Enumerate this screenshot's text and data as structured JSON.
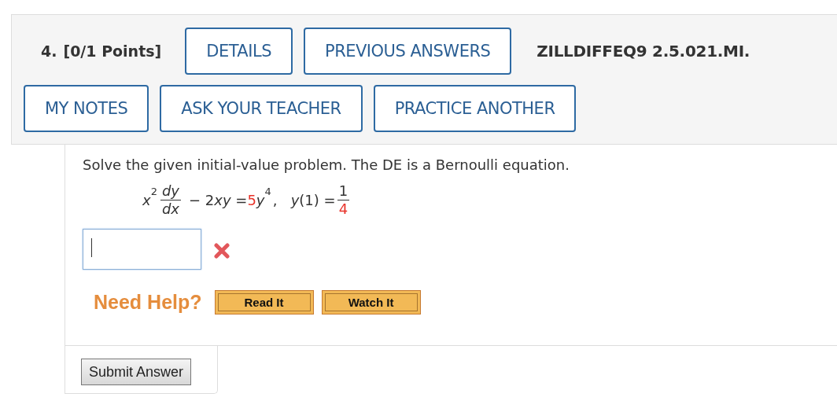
{
  "question": {
    "number": "4.",
    "points": "[0/1 Points]",
    "code": "ZILLDIFFEQ9 2.5.021.MI."
  },
  "header_buttons_row1": [
    {
      "label": "DETAILS"
    },
    {
      "label": "PREVIOUS ANSWERS"
    }
  ],
  "header_buttons_row2": [
    {
      "label": "MY NOTES"
    },
    {
      "label": "ASK YOUR TEACHER"
    },
    {
      "label": "PRACTICE ANOTHER"
    }
  ],
  "prompt": "Solve the given initial-value problem. The DE is a Bernoulli equation.",
  "equation": [
    {
      "kind": "text",
      "text": "x",
      "italic": true
    },
    {
      "kind": "sup",
      "text": "2"
    },
    {
      "kind": "frac",
      "num": "dy",
      "den": "dx",
      "italic": true
    },
    {
      "kind": "text",
      "text": "− 2",
      "italic": false
    },
    {
      "kind": "text",
      "text": "xy",
      "italic": true
    },
    {
      "kind": "text",
      "text": " ="
    },
    {
      "kind": "text",
      "text": "5",
      "italic": false,
      "highlight": true
    },
    {
      "kind": "text",
      "text": "y",
      "italic": true
    },
    {
      "kind": "sup",
      "text": "4"
    },
    {
      "kind": "text",
      "text": ",   "
    },
    {
      "kind": "text",
      "text": "y",
      "italic": true
    },
    {
      "kind": "text",
      "text": "(1) =",
      "italic": false
    },
    {
      "kind": "frac",
      "num": "1",
      "den": "4",
      "italic": false,
      "den_highlight": true
    }
  ],
  "answer_field": {
    "focused": true,
    "correct": false
  },
  "help": {
    "label": "Need Help?",
    "buttons": [
      {
        "label": "Read It"
      },
      {
        "label": "Watch It"
      }
    ]
  },
  "submit_button": "Submit Answer"
}
